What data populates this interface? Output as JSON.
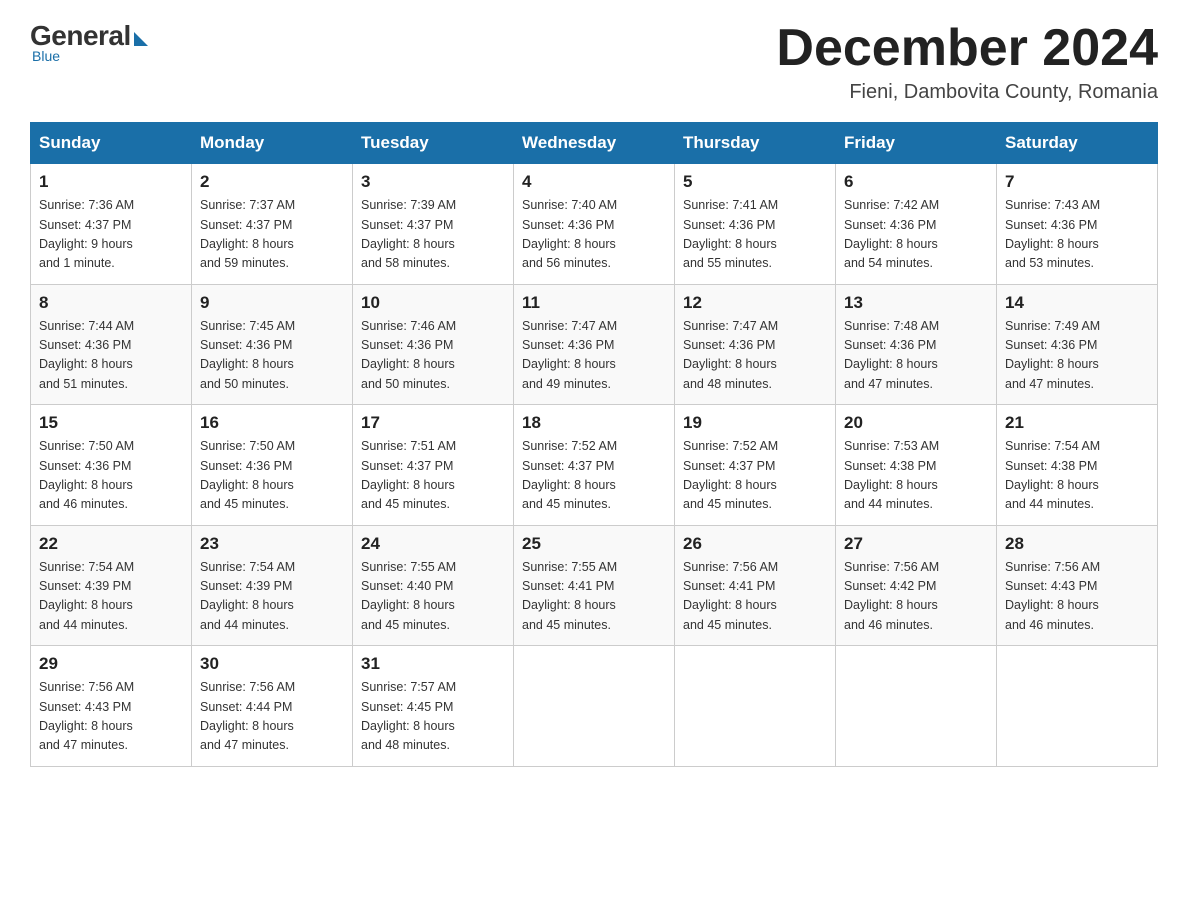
{
  "logo": {
    "general": "General",
    "blue": "Blue",
    "subtitle": "Blue"
  },
  "header": {
    "month_year": "December 2024",
    "location": "Fieni, Dambovita County, Romania"
  },
  "weekdays": [
    "Sunday",
    "Monday",
    "Tuesday",
    "Wednesday",
    "Thursday",
    "Friday",
    "Saturday"
  ],
  "weeks": [
    [
      {
        "day": "1",
        "sunrise": "7:36 AM",
        "sunset": "4:37 PM",
        "daylight": "9 hours and 1 minute."
      },
      {
        "day": "2",
        "sunrise": "7:37 AM",
        "sunset": "4:37 PM",
        "daylight": "8 hours and 59 minutes."
      },
      {
        "day": "3",
        "sunrise": "7:39 AM",
        "sunset": "4:37 PM",
        "daylight": "8 hours and 58 minutes."
      },
      {
        "day": "4",
        "sunrise": "7:40 AM",
        "sunset": "4:36 PM",
        "daylight": "8 hours and 56 minutes."
      },
      {
        "day": "5",
        "sunrise": "7:41 AM",
        "sunset": "4:36 PM",
        "daylight": "8 hours and 55 minutes."
      },
      {
        "day": "6",
        "sunrise": "7:42 AM",
        "sunset": "4:36 PM",
        "daylight": "8 hours and 54 minutes."
      },
      {
        "day": "7",
        "sunrise": "7:43 AM",
        "sunset": "4:36 PM",
        "daylight": "8 hours and 53 minutes."
      }
    ],
    [
      {
        "day": "8",
        "sunrise": "7:44 AM",
        "sunset": "4:36 PM",
        "daylight": "8 hours and 51 minutes."
      },
      {
        "day": "9",
        "sunrise": "7:45 AM",
        "sunset": "4:36 PM",
        "daylight": "8 hours and 50 minutes."
      },
      {
        "day": "10",
        "sunrise": "7:46 AM",
        "sunset": "4:36 PM",
        "daylight": "8 hours and 50 minutes."
      },
      {
        "day": "11",
        "sunrise": "7:47 AM",
        "sunset": "4:36 PM",
        "daylight": "8 hours and 49 minutes."
      },
      {
        "day": "12",
        "sunrise": "7:47 AM",
        "sunset": "4:36 PM",
        "daylight": "8 hours and 48 minutes."
      },
      {
        "day": "13",
        "sunrise": "7:48 AM",
        "sunset": "4:36 PM",
        "daylight": "8 hours and 47 minutes."
      },
      {
        "day": "14",
        "sunrise": "7:49 AM",
        "sunset": "4:36 PM",
        "daylight": "8 hours and 47 minutes."
      }
    ],
    [
      {
        "day": "15",
        "sunrise": "7:50 AM",
        "sunset": "4:36 PM",
        "daylight": "8 hours and 46 minutes."
      },
      {
        "day": "16",
        "sunrise": "7:50 AM",
        "sunset": "4:36 PM",
        "daylight": "8 hours and 45 minutes."
      },
      {
        "day": "17",
        "sunrise": "7:51 AM",
        "sunset": "4:37 PM",
        "daylight": "8 hours and 45 minutes."
      },
      {
        "day": "18",
        "sunrise": "7:52 AM",
        "sunset": "4:37 PM",
        "daylight": "8 hours and 45 minutes."
      },
      {
        "day": "19",
        "sunrise": "7:52 AM",
        "sunset": "4:37 PM",
        "daylight": "8 hours and 45 minutes."
      },
      {
        "day": "20",
        "sunrise": "7:53 AM",
        "sunset": "4:38 PM",
        "daylight": "8 hours and 44 minutes."
      },
      {
        "day": "21",
        "sunrise": "7:54 AM",
        "sunset": "4:38 PM",
        "daylight": "8 hours and 44 minutes."
      }
    ],
    [
      {
        "day": "22",
        "sunrise": "7:54 AM",
        "sunset": "4:39 PM",
        "daylight": "8 hours and 44 minutes."
      },
      {
        "day": "23",
        "sunrise": "7:54 AM",
        "sunset": "4:39 PM",
        "daylight": "8 hours and 44 minutes."
      },
      {
        "day": "24",
        "sunrise": "7:55 AM",
        "sunset": "4:40 PM",
        "daylight": "8 hours and 45 minutes."
      },
      {
        "day": "25",
        "sunrise": "7:55 AM",
        "sunset": "4:41 PM",
        "daylight": "8 hours and 45 minutes."
      },
      {
        "day": "26",
        "sunrise": "7:56 AM",
        "sunset": "4:41 PM",
        "daylight": "8 hours and 45 minutes."
      },
      {
        "day": "27",
        "sunrise": "7:56 AM",
        "sunset": "4:42 PM",
        "daylight": "8 hours and 46 minutes."
      },
      {
        "day": "28",
        "sunrise": "7:56 AM",
        "sunset": "4:43 PM",
        "daylight": "8 hours and 46 minutes."
      }
    ],
    [
      {
        "day": "29",
        "sunrise": "7:56 AM",
        "sunset": "4:43 PM",
        "daylight": "8 hours and 47 minutes."
      },
      {
        "day": "30",
        "sunrise": "7:56 AM",
        "sunset": "4:44 PM",
        "daylight": "8 hours and 47 minutes."
      },
      {
        "day": "31",
        "sunrise": "7:57 AM",
        "sunset": "4:45 PM",
        "daylight": "8 hours and 48 minutes."
      },
      null,
      null,
      null,
      null
    ]
  ],
  "labels": {
    "sunrise": "Sunrise:",
    "sunset": "Sunset:",
    "daylight": "Daylight:"
  }
}
